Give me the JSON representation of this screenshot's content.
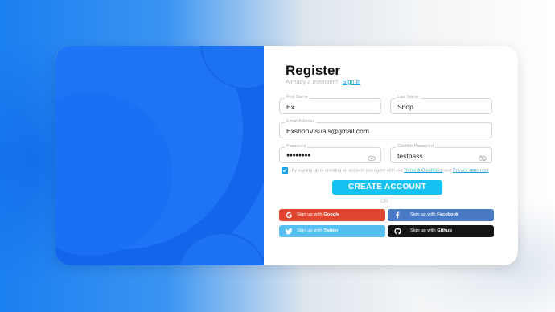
{
  "register": {
    "title": "Register",
    "already_member": "Already a member?",
    "sign_in": "Sign in"
  },
  "fields": {
    "first_name": {
      "label": "First Name",
      "value": "Ex"
    },
    "last_name": {
      "label": "Last Name",
      "value": "Shop"
    },
    "email": {
      "label": "Email Address",
      "value": "ExshopVisuals@gmail.com"
    },
    "password": {
      "label": "Password",
      "value": "●●●●●●●●"
    },
    "confirm_password": {
      "label": "Confirm Password",
      "value": "testpass"
    }
  },
  "terms": {
    "checked": true,
    "text": "By signing up or creating an account you agree with our",
    "terms_link": "Terms & Conditions",
    "and": "and",
    "privacy_link": "Privacy statement"
  },
  "create_account": "CREATE ACCOUNT",
  "or": "OR",
  "social": {
    "google": {
      "prefix": "Sign up with",
      "name": "Google"
    },
    "facebook": {
      "prefix": "Sign up with",
      "name": "Facebook"
    },
    "twitter": {
      "prefix": "Sign up with",
      "name": "Twitter"
    },
    "github": {
      "prefix": "Sign up with",
      "name": "Github"
    }
  },
  "colors": {
    "primary_blue": "#1f74f5",
    "accent_cyan": "#16c2f2",
    "google": "#e0452f",
    "facebook": "#4a79c5",
    "twitter": "#54bff0",
    "github": "#151515"
  }
}
